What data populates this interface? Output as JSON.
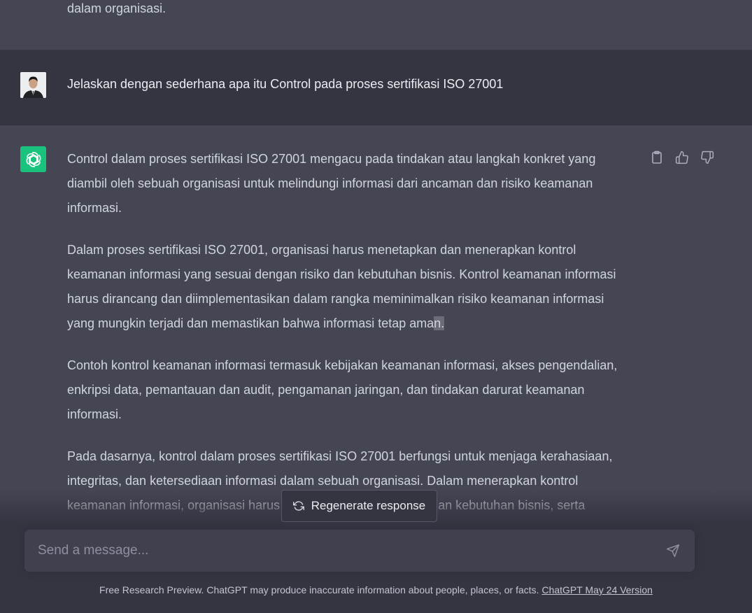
{
  "previous_message": {
    "tail_text": "dalam organisasi."
  },
  "user_message": {
    "text": "Jelaskan dengan sederhana apa itu Control pada proses sertifikasi ISO 27001"
  },
  "assistant_message": {
    "paragraphs": [
      "Control dalam proses sertifikasi ISO 27001 mengacu pada tindakan atau langkah konkret yang diambil oleh sebuah organisasi untuk melindungi informasi dari ancaman dan risiko keamanan informasi.",
      "Dalam proses sertifikasi ISO 27001, organisasi harus menetapkan dan menerapkan kontrol keamanan informasi yang sesuai dengan risiko dan kebutuhan bisnis. Kontrol keamanan informasi harus dirancang dan diimplementasikan dalam rangka meminimalkan risiko keamanan informasi yang mungkin terjadi dan memastikan bahwa informasi tetap ama",
      "Contoh kontrol keamanan informasi termasuk kebijakan keamanan informasi, akses pengendalian, enkripsi data, pemantauan dan audit, pengamanan jaringan, dan tindakan darurat keamanan informasi.",
      "Pada dasarnya, kontrol dalam proses sertifikasi ISO 27001 berfungsi untuk menjaga kerahasiaan, integritas, dan ketersediaan informasi dalam sebuah organisasi. Dalam menerapkan kontrol keamanan informasi, organisasi harus mempertimbangkan risiko dan kebutuhan bisnis, serta memastikan bahwa kontrol tersebut secara efektif mengurangi"
    ],
    "streaming_caret_text": "n.",
    "actions": {
      "copy_icon": "clipboard-icon",
      "like_icon": "thumbs-up-icon",
      "dislike_icon": "thumbs-down-icon"
    }
  },
  "regenerate_button": {
    "label": "Regenerate response",
    "icon": "refresh-icon"
  },
  "composer": {
    "placeholder": "Send a message...",
    "value": "",
    "send_icon": "paper-plane-icon"
  },
  "footer": {
    "text": "Free Research Preview. ChatGPT may produce inaccurate information about people, places, or facts. ",
    "link_text": "ChatGPT May 24 Version"
  },
  "colors": {
    "assistant_bg": "#444654",
    "user_bg": "#343541",
    "accent_green": "#19c37d",
    "input_bg": "#40414f"
  }
}
